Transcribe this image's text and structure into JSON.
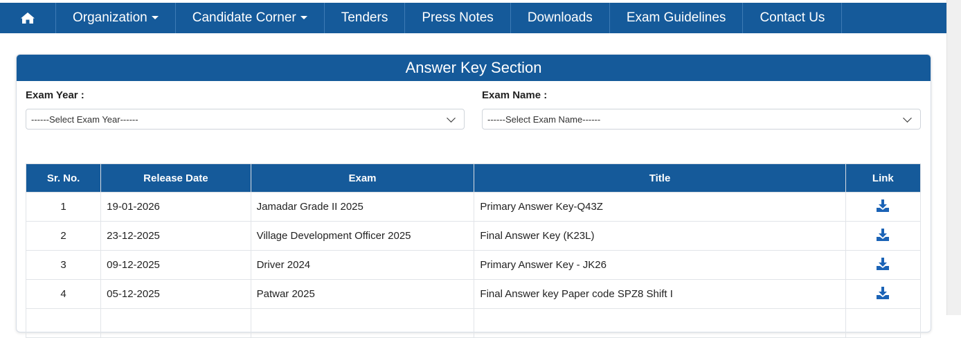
{
  "nav": {
    "items": [
      {
        "label": "Organization",
        "dropdown": true
      },
      {
        "label": "Candidate Corner",
        "dropdown": true
      },
      {
        "label": "Tenders",
        "dropdown": false
      },
      {
        "label": "Press Notes",
        "dropdown": false
      },
      {
        "label": "Downloads",
        "dropdown": false
      },
      {
        "label": "Exam Guidelines",
        "dropdown": false
      },
      {
        "label": "Contact Us",
        "dropdown": false
      }
    ]
  },
  "section": {
    "title": "Answer Key Section",
    "exam_year_label": "Exam Year :",
    "exam_year_value": "------Select Exam Year------",
    "exam_name_label": "Exam Name :",
    "exam_name_value": "------Select Exam Name------"
  },
  "table": {
    "headers": [
      "Sr. No.",
      "Release Date",
      "Exam",
      "Title",
      "Link"
    ],
    "rows": [
      {
        "sr": "1",
        "date": "19-01-2026",
        "exam": "Jamadar Grade II 2025",
        "title": "Primary Answer Key-Q43Z"
      },
      {
        "sr": "2",
        "date": "23-12-2025",
        "exam": "Village Development Officer 2025",
        "title": "Final Answer Key (K23L)"
      },
      {
        "sr": "3",
        "date": "09-12-2025",
        "exam": "Driver 2024",
        "title": "Primary Answer Key - JK26"
      },
      {
        "sr": "4",
        "date": "05-12-2025",
        "exam": "Patwar 2025",
        "title": "Final Answer key Paper code SPZ8 Shift I"
      },
      {
        "sr": "",
        "date": "",
        "exam": "",
        "title": ""
      }
    ]
  },
  "icons": {
    "home": "home-icon",
    "download": "download-icon"
  },
  "colors": {
    "brand": "#155a9a",
    "link_icon": "#1b63b6"
  }
}
